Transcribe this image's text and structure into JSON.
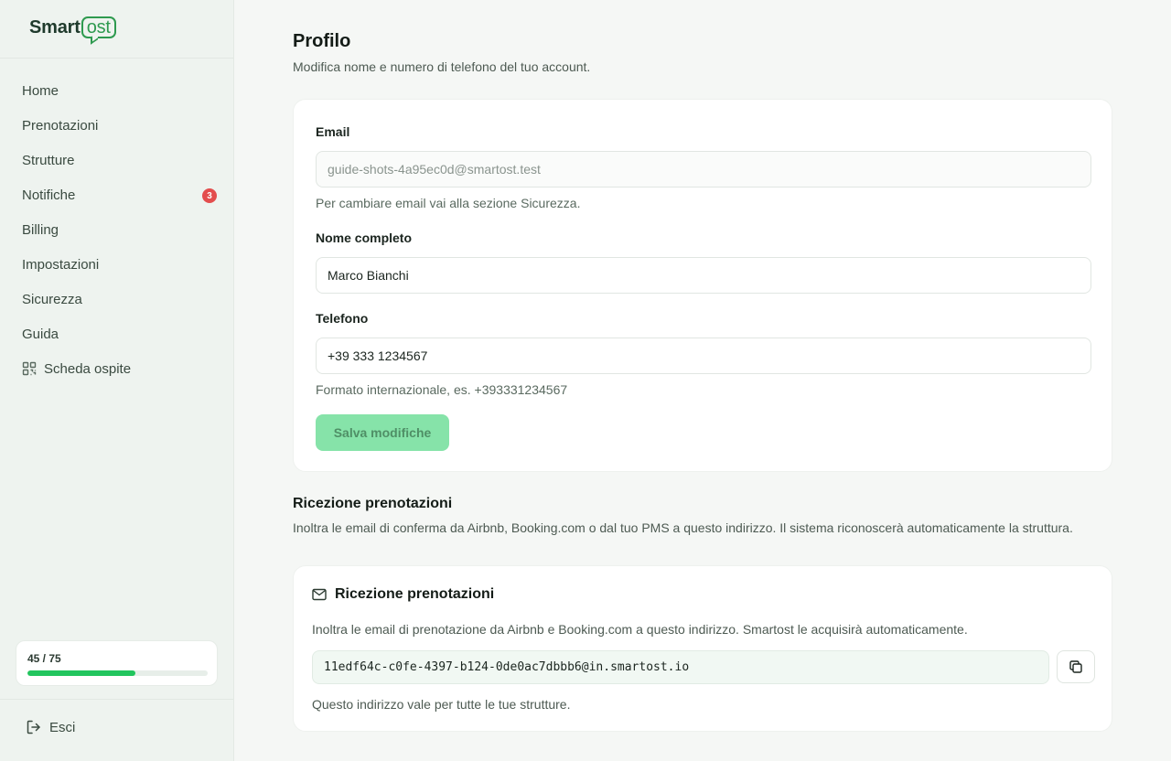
{
  "brand": {
    "name_prefix": "Smart",
    "name_suffix": "ost",
    "accent": "#2e9a4f"
  },
  "sidebar": {
    "items": [
      {
        "label": "Home"
      },
      {
        "label": "Prenotazioni"
      },
      {
        "label": "Strutture"
      },
      {
        "label": "Notifiche",
        "badge": "3"
      },
      {
        "label": "Billing"
      },
      {
        "label": "Impostazioni"
      },
      {
        "label": "Sicurezza"
      },
      {
        "label": "Guida"
      },
      {
        "label": "Scheda ospite",
        "icon": "qr-code-icon"
      }
    ],
    "quota": {
      "text": "45 / 75",
      "used": 45,
      "total": 75
    },
    "logout_label": "Esci"
  },
  "profile": {
    "title": "Profilo",
    "subtitle": "Modifica nome e numero di telefono del tuo account.",
    "email_label": "Email",
    "email_value": "guide-shots-4a95ec0d@smartost.test",
    "email_hint": "Per cambiare email vai alla sezione Sicurezza.",
    "name_label": "Nome completo",
    "name_value": "Marco Bianchi",
    "phone_label": "Telefono",
    "phone_value": "+39 333 1234567",
    "phone_hint": "Formato internazionale, es. +393331234567",
    "save_label": "Salva modifiche"
  },
  "bookings": {
    "section_title": "Ricezione prenotazioni",
    "section_desc": "Inoltra le email di conferma da Airbnb, Booking.com o dal tuo PMS a questo indirizzo. Il sistema riconoscerà automaticamente la struttura.",
    "card_title": "Ricezione prenotazioni",
    "card_desc": "Inoltra le email di prenotazione da Airbnb e Booking.com a questo indirizzo. Smartost le acquisirà automaticamente.",
    "address": "11edf64c-c0fe-4397-b124-0de0ac7dbbb6@in.smartost.io",
    "footer": "Questo indirizzo vale per tutte le tue strutture."
  }
}
